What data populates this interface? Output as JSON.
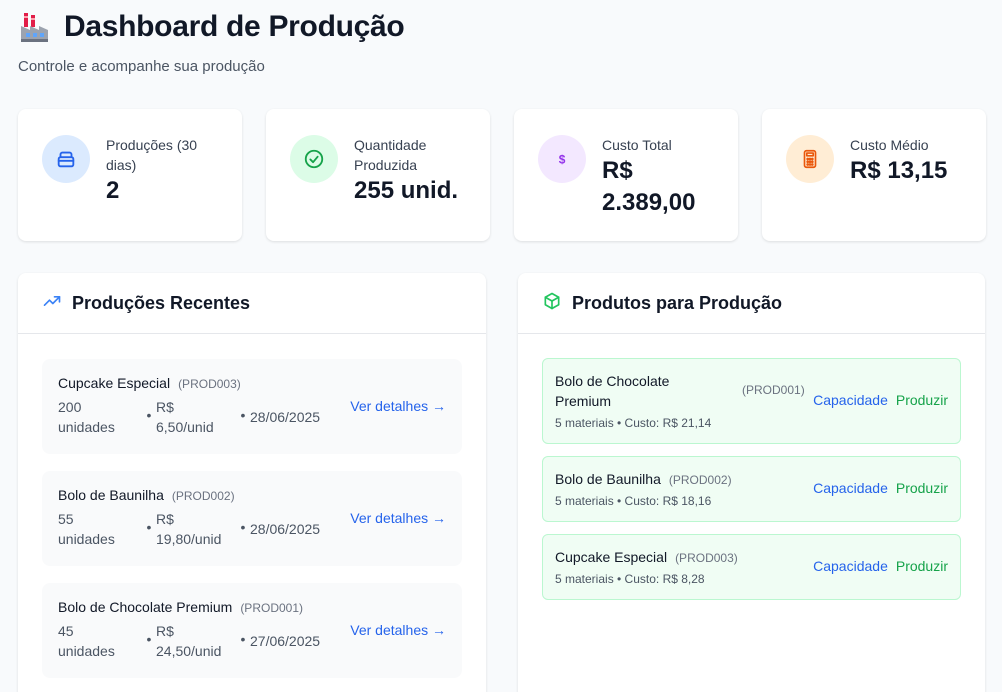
{
  "header": {
    "title": "Dashboard de Produção",
    "subtitle": "Controle e acompanhe sua produção"
  },
  "stats": [
    {
      "label_l1": "Produções (30",
      "label_l2": "dias)",
      "value_l1": "2",
      "value_l2": "",
      "icon": "box-icon",
      "color": "#3b82f6"
    },
    {
      "label_l1": "Quantidade",
      "label_l2": "Produzida",
      "value_l1": "255 unid.",
      "value_l2": "",
      "icon": "check-circle-icon",
      "color": "#16a34a"
    },
    {
      "label_l1": "Custo Total",
      "label_l2": "",
      "value_l1": "R$",
      "value_l2": "2.389,00",
      "icon": "dollar-icon",
      "color": "#9333ea"
    },
    {
      "label_l1": "Custo Médio",
      "label_l2": "",
      "value_l1": "R$ 13,15",
      "value_l2": "",
      "icon": "calculator-icon",
      "color": "#ea580c"
    }
  ],
  "recent": {
    "title": "Produções Recentes",
    "items": [
      {
        "name": "Cupcake Especial",
        "code": "(PROD003)",
        "qty_l1": "200",
        "qty_l2": "unidades",
        "cost_l1": "R$",
        "cost_l2": "6,50/unid",
        "date": "28/06/2025",
        "link": "Ver detalhes →"
      },
      {
        "name": "Bolo de Baunilha",
        "code": "(PROD002)",
        "qty_l1": "55",
        "qty_l2": "unidades",
        "cost_l1": "R$",
        "cost_l2": "19,80/unid",
        "date": "28/06/2025",
        "link": "Ver detalhes →"
      },
      {
        "name": "Bolo de Chocolate Premium",
        "code": "(PROD001)",
        "qty_l1": "45",
        "qty_l2": "unidades",
        "cost_l1": "R$",
        "cost_l2": "24,50/unid",
        "date": "27/06/2025",
        "link": "Ver detalhes →"
      }
    ]
  },
  "products": {
    "title": "Produtos para Produção",
    "items": [
      {
        "name_l1": "Bolo de Chocolate",
        "name_l2": "Premium",
        "code": "(PROD001)",
        "sub": "5 materiais • Custo: R$ 21,14",
        "capacity": "Capacidade",
        "produce": "Produzir"
      },
      {
        "name_l1": "Bolo de Baunilha",
        "name_l2": "",
        "code": "(PROD002)",
        "sub": "5 materiais • Custo: R$ 18,16",
        "capacity": "Capacidade",
        "produce": "Produzir"
      },
      {
        "name_l1": "Cupcake Especial",
        "name_l2": "",
        "code": "(PROD003)",
        "sub": "5 materiais • Custo: R$ 8,28",
        "capacity": "Capacidade",
        "produce": "Produzir"
      }
    ]
  }
}
